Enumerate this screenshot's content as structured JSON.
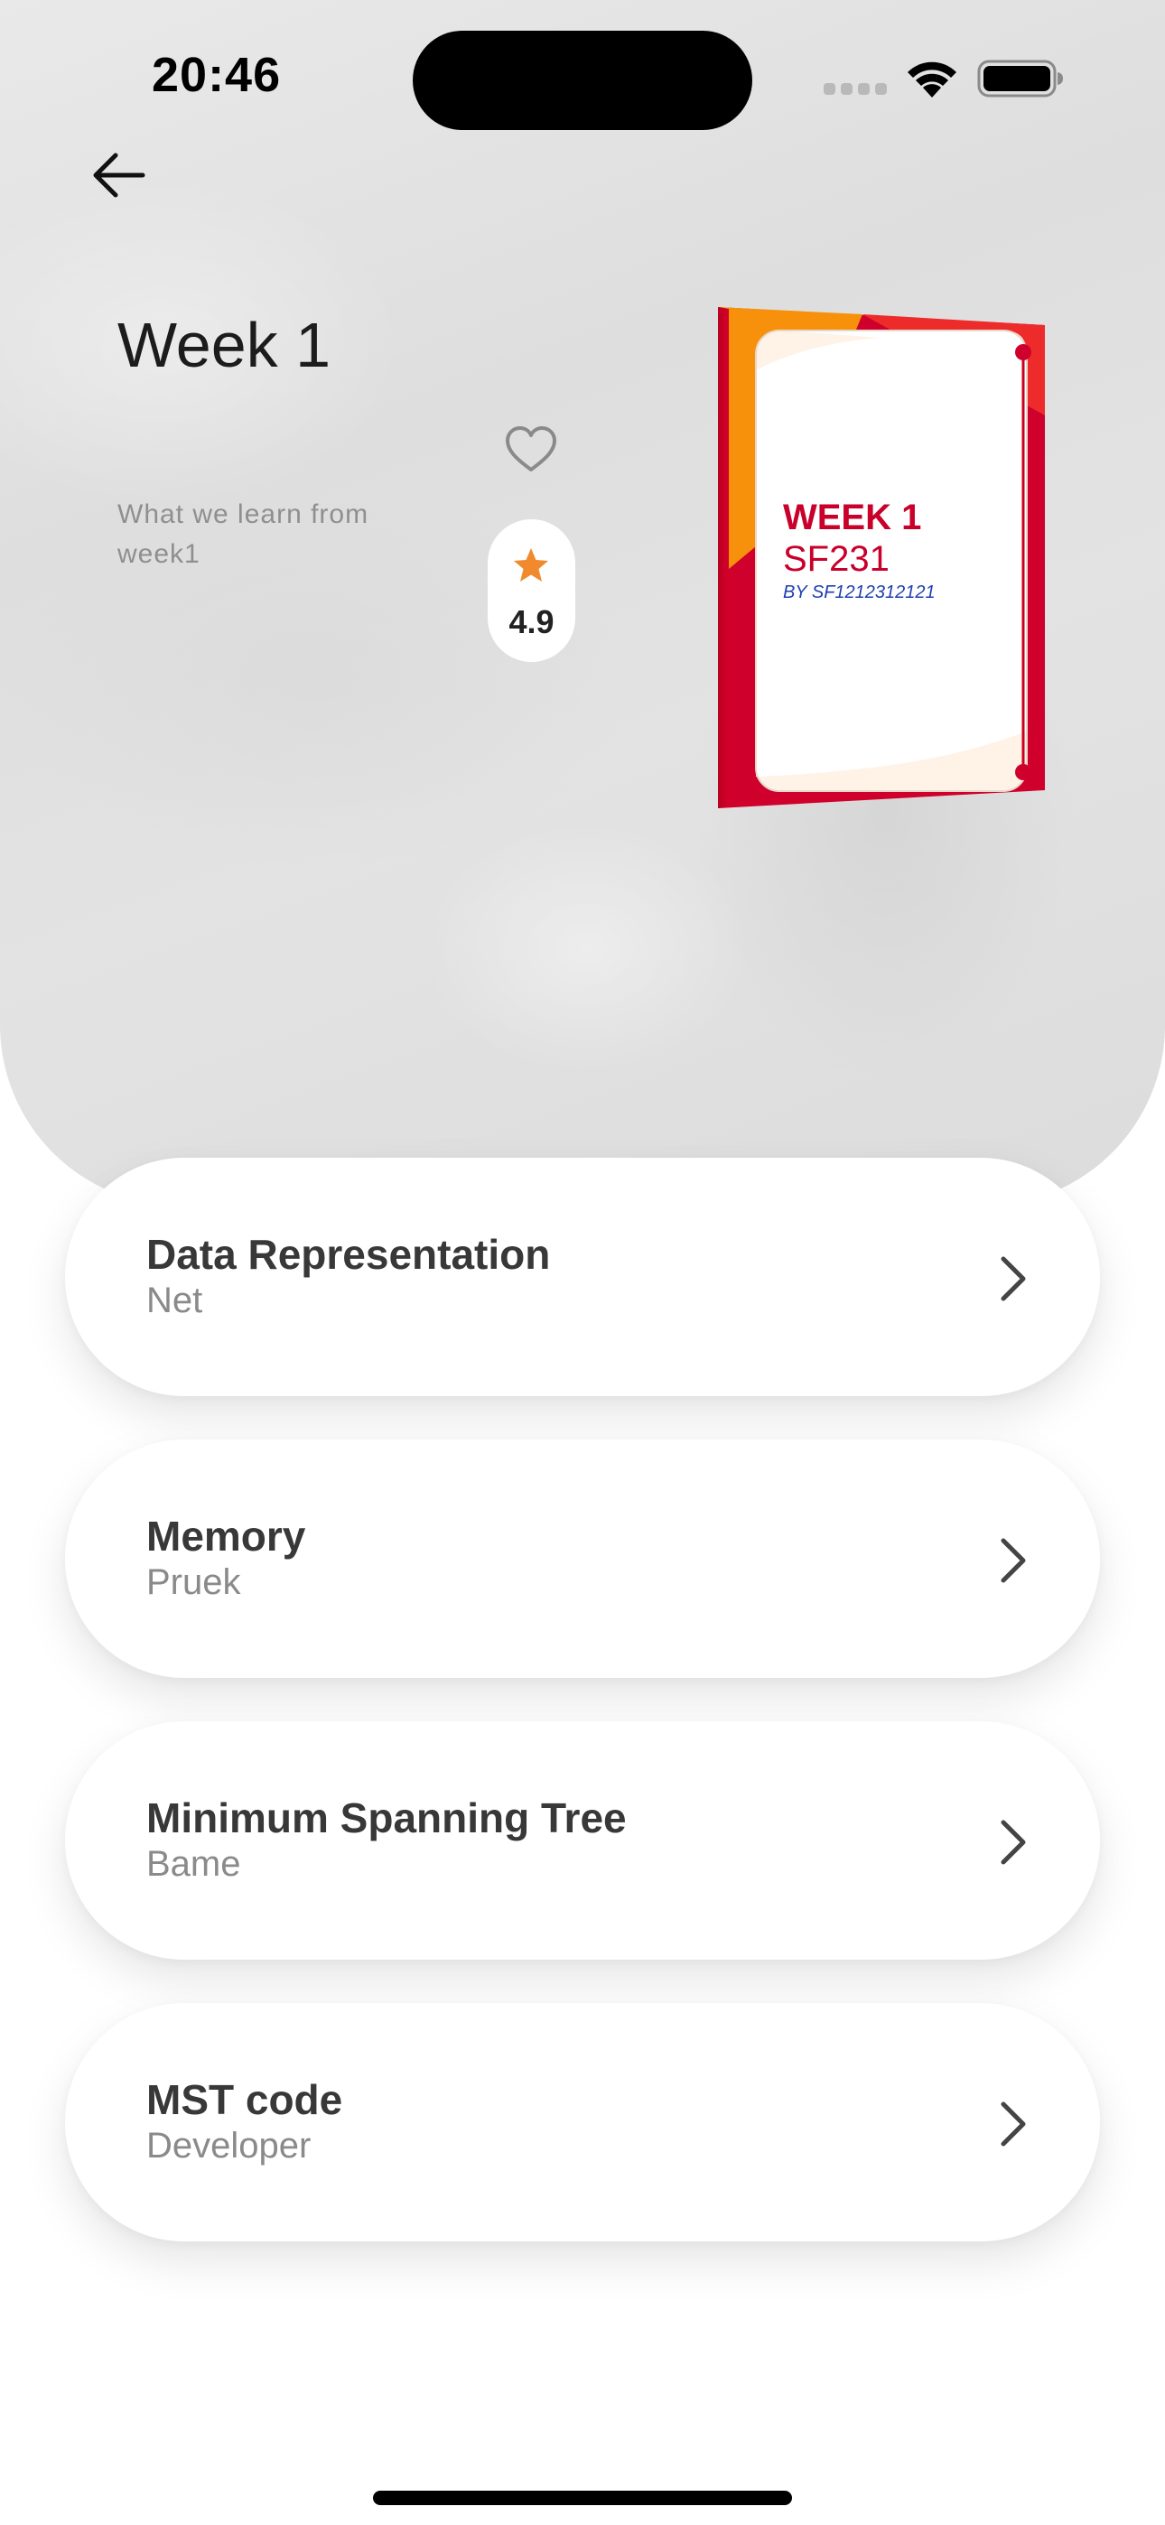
{
  "status_bar": {
    "time": "20:46"
  },
  "header": {
    "title": "Week 1",
    "description": "What we learn from week1",
    "rating": "4.9",
    "accent_color": "#f08a2c"
  },
  "cover": {
    "heading": "WEEK 1",
    "course": "SF231",
    "author_line": "BY SF1212312121"
  },
  "lessons": [
    {
      "title": "Data Representation",
      "subtitle": "Net"
    },
    {
      "title": "Memory",
      "subtitle": "Pruek"
    },
    {
      "title": "Minimum Spanning Tree",
      "subtitle": "Bame"
    },
    {
      "title": "MST code",
      "subtitle": "Developer"
    }
  ],
  "icons": {
    "back": "arrow-left-icon",
    "favorite": "heart-outline-icon",
    "rating": "star-icon",
    "chevron": "chevron-right-icon"
  }
}
